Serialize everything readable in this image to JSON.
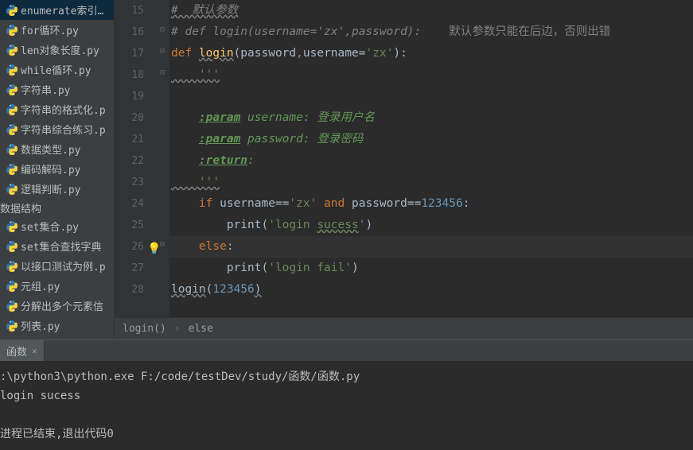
{
  "sidebar": {
    "files1": [
      "enumerate索引…",
      "for循环.py",
      "len对象长度.py",
      "while循环.py",
      "字符串.py",
      "字符串的格式化.p",
      "字符串综合练习.p",
      "数据类型.py",
      "编码解码.py",
      "逻辑判断.py"
    ],
    "folder": "数据结构",
    "files2": [
      "set集合.py",
      "set集合查找字典",
      "以接口测试为例.p",
      "元组.py",
      "分解出多个元素信",
      "列表.py"
    ]
  },
  "gutter": [
    "15",
    "16",
    "17",
    "18",
    "19",
    "20",
    "21",
    "22",
    "23",
    "24",
    "25",
    "26",
    "27",
    "28"
  ],
  "code": {
    "l15": "#  默认参数",
    "l16a": "# def login(username='zx',password):    ",
    "l16b": "默认参数只能在后边，否则出错",
    "l17_def": "def ",
    "l17_fn": "login",
    "l17_p1": "(password",
    "l17_comma": ",",
    "l17_p2": "username=",
    "l17_str": "'zx'",
    "l17_end": "):",
    "l18": "    '''",
    "l20a": "    ",
    "l20tag": ":param",
    "l20b": " username: ",
    "l20c": "登录用户名",
    "l21tag": ":param",
    "l21b": " password: ",
    "l21c": "登录密码",
    "l22tag": ":return",
    "l22b": ":",
    "l23": "    '''",
    "l24_if": "    if ",
    "l24_a": "username==",
    "l24_s1": "'zx'",
    "l24_and": " and ",
    "l24_b": "password==",
    "l24_n": "123456",
    "l24_c": ":",
    "l25_a": "        print(",
    "l25_s": "'login ",
    "l25_t": "sucess",
    "l25_s2": "'",
    "l25_b": ")",
    "l26_else": "    else",
    "l26_c": ":",
    "l27_a": "        print(",
    "l27_s": "'login fail'",
    "l27_b": ")",
    "l28_fn": "login",
    "l28_a": "(",
    "l28_n": "123456",
    "l28_b": ")"
  },
  "breadcrumb": {
    "a": "login()",
    "b": "else"
  },
  "console": {
    "tab": "函数",
    "cmd": ":\\python3\\python.exe F:/code/testDev/study/函数/函数.py",
    "out": "login sucess",
    "exit": "进程已结束,退出代码0"
  }
}
